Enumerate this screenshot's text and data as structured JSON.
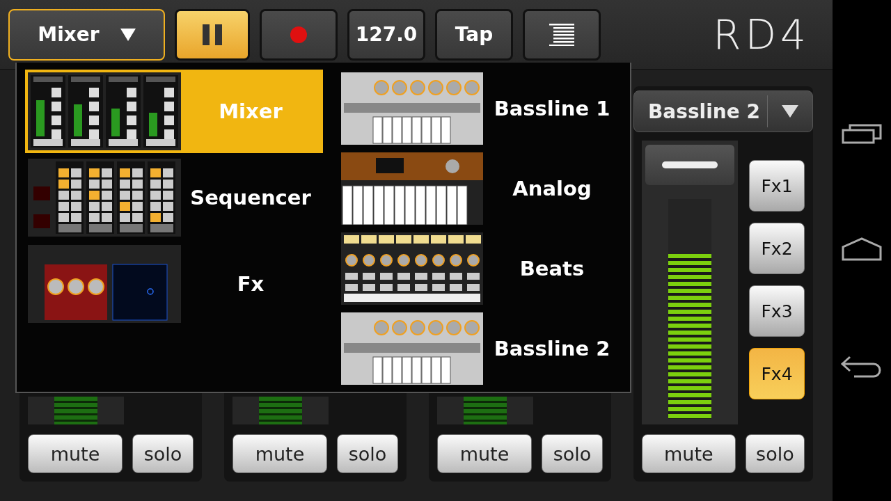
{
  "toolbar": {
    "section_menu": {
      "label": "Mixer"
    },
    "transport": {
      "playing": true
    },
    "tempo": "127.0",
    "tap": "Tap"
  },
  "logo": "RD4",
  "section_menu_panel": {
    "columns": [
      {
        "items": [
          {
            "label": "Mixer",
            "kind": "mixer",
            "selected": true
          },
          {
            "label": "Sequencer",
            "kind": "sequencer",
            "selected": false
          },
          {
            "label": "Fx",
            "kind": "fx",
            "selected": false
          }
        ]
      },
      {
        "items": [
          {
            "label": "Bassline 1",
            "kind": "bassline",
            "selected": false
          },
          {
            "label": "Analog",
            "kind": "analog",
            "selected": false
          },
          {
            "label": "Beats",
            "kind": "beats",
            "selected": false
          },
          {
            "label": "Bassline 2",
            "kind": "bassline",
            "selected": false
          }
        ]
      }
    ]
  },
  "channels": [
    {
      "mute": "mute",
      "solo": "solo"
    },
    {
      "mute": "mute",
      "solo": "solo"
    },
    {
      "mute": "mute",
      "solo": "solo"
    }
  ],
  "focused_channel": {
    "name": "Bassline 2",
    "level": 0.75,
    "fx": [
      {
        "label": "Fx1",
        "selected": false
      },
      {
        "label": "Fx2",
        "selected": false
      },
      {
        "label": "Fx3",
        "selected": false
      },
      {
        "label": "Fx4",
        "selected": true
      }
    ],
    "mute": "mute",
    "solo": "solo"
  }
}
